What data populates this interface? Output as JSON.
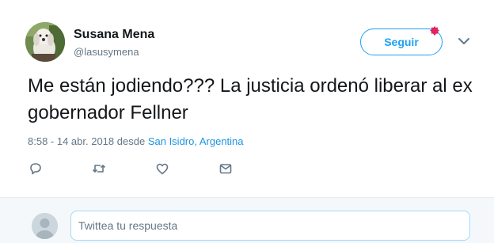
{
  "tweet": {
    "author": {
      "display_name": "Susana Mena",
      "handle": "@lasusymena",
      "avatar_icon": "profile-photo-dog"
    },
    "follow_label": "Seguir",
    "text": "Me están jodiendo??? La justicia ordenó liberar al ex gobernador Fellner",
    "timestamp": "8:58 - 14 abr. 2018",
    "from_label": "desde",
    "location": "San Isidro, Argentina",
    "actions": [
      {
        "icon": "reply-icon"
      },
      {
        "icon": "retweet-icon"
      },
      {
        "icon": "like-icon"
      },
      {
        "icon": "direct-message-icon"
      }
    ]
  },
  "reply": {
    "placeholder": "Twittea tu respuesta"
  },
  "colors": {
    "accent": "#1da1f2",
    "link": "#1b95e0",
    "muted": "#657786",
    "text": "#14171a",
    "reply_bar_bg": "#f5f8fa"
  }
}
